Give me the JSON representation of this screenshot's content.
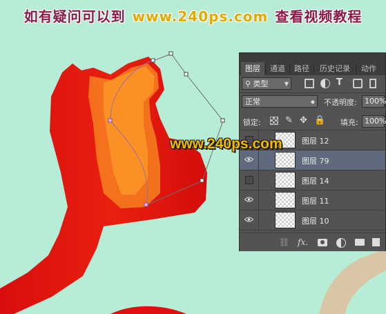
{
  "banner": {
    "part1": "如有疑问可以到",
    "part2": "www.240ps.com",
    "part3": "查看视频教程"
  },
  "watermark": "www.240ps.com",
  "panel": {
    "tabs": [
      "图层",
      "通道",
      "路径",
      "历史记录",
      "动作"
    ],
    "active_tab": "图层",
    "filter_select": "类型",
    "blend_mode": "正常",
    "opacity_label": "不透明度:",
    "opacity_value": "100%",
    "lock_label": "锁定:",
    "fill_label": "填充:",
    "fill_value": "100%",
    "layers": [
      {
        "name": "图层 12",
        "visible": false,
        "selected": false
      },
      {
        "name": "图层 79",
        "visible": true,
        "selected": true
      },
      {
        "name": "图层 14",
        "visible": false,
        "selected": false
      },
      {
        "name": "图层 11",
        "visible": true,
        "selected": false
      },
      {
        "name": "图层 10",
        "visible": true,
        "selected": false
      }
    ],
    "bottom_icons": [
      "link-icon",
      "fx-icon",
      "mask-icon",
      "adjustment-icon",
      "folder-icon",
      "new-layer-icon"
    ],
    "fx_label": "fx."
  },
  "colors": {
    "background": "#b7ecd6",
    "shape_red": "#e01010",
    "shape_orange": "#f7811f",
    "path": "#9a6fa8",
    "selected_layer": "#5f6b7c"
  }
}
